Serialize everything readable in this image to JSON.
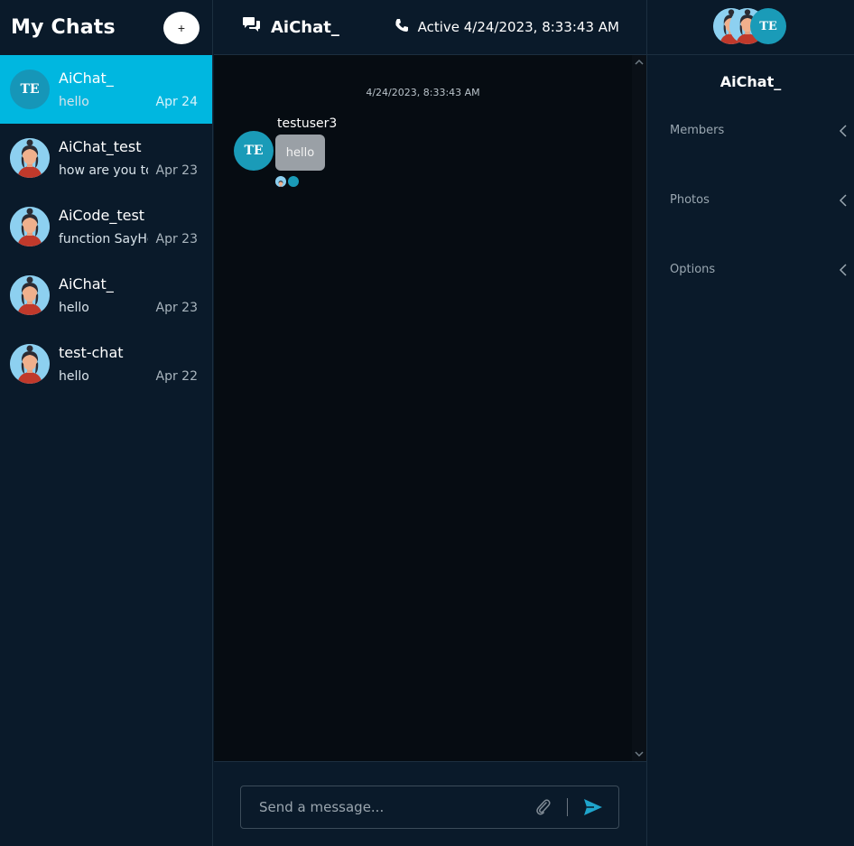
{
  "sidebar": {
    "title": "My Chats",
    "new_chat_label": "+",
    "chats": [
      {
        "name": "AiChat_",
        "preview": "hello",
        "date": "Apr 24",
        "avatar": "TE",
        "active": true
      },
      {
        "name": "AiChat_test",
        "preview": "how are you today",
        "date": "Apr 23",
        "avatar": "female-avatar-icon"
      },
      {
        "name": "AiCode_test",
        "preview": "function SayHello",
        "date": "Apr 23",
        "avatar": "female-avatar-icon"
      },
      {
        "name": "AiChat_",
        "preview": "hello",
        "date": "Apr 23",
        "avatar": "female-avatar-icon"
      },
      {
        "name": "test-chat",
        "preview": "hello",
        "date": "Apr 22",
        "avatar": "female-avatar-icon"
      }
    ]
  },
  "header": {
    "title": "AiChat_",
    "status": "Active 4/24/2023, 8:33:43 AM",
    "chat_icon": "chat-bubbles-icon",
    "phone_icon": "phone-icon"
  },
  "conversation": {
    "date_separator": "4/24/2023, 8:33:43 AM",
    "messages": [
      {
        "sender": "testuser3",
        "avatar": "TE",
        "text": "hello"
      }
    ]
  },
  "composer": {
    "placeholder": "Send a message...",
    "attach_icon": "paperclip-icon",
    "send_icon": "send-icon"
  },
  "details": {
    "title": "AiChat_",
    "avatar_initials": "TE",
    "sections": [
      {
        "label": "Members"
      },
      {
        "label": "Photos"
      },
      {
        "label": "Options"
      }
    ]
  },
  "colors": {
    "background": "#0a1a2a",
    "active_chat": "#00b7e0",
    "te_avatar": "#1a9bb8",
    "message_bubble": "#9aa0a6",
    "message_area": "#060c12"
  }
}
